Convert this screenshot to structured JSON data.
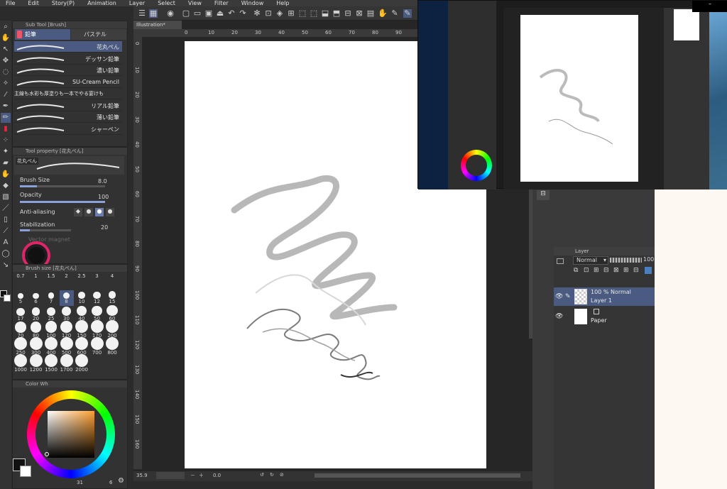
{
  "menubar": {
    "items": [
      "File",
      "Edit",
      "Story(P)",
      "Animation",
      "Layer",
      "Select",
      "View",
      "Filter",
      "Window",
      "Help"
    ]
  },
  "canvas": {
    "tab_title": "Illustration*",
    "ruler_top": [
      "0",
      "10",
      "20",
      "30",
      "40",
      "50",
      "60",
      "70",
      "80",
      "90",
      "100",
      "110",
      "120"
    ],
    "ruler_left": [
      "0",
      "10",
      "20",
      "30",
      "40",
      "50",
      "60",
      "70",
      "80",
      "90",
      "100",
      "110",
      "120",
      "130",
      "140",
      "150",
      "160"
    ],
    "zoom": "35.9",
    "angle": "0.0"
  },
  "subtool": {
    "header": "Sub Tool [Brush]",
    "tabs": [
      "鉛筆",
      "パステル"
    ],
    "brushes": [
      "花丸ぺん",
      "デッサン鉛筆",
      "濃い鉛筆",
      "SU-Cream Pencil",
      "主線も水彩も厚塗りも一本でやる宴けも",
      "リアル鉛筆",
      "薄い鉛筆",
      "シャーペン"
    ]
  },
  "toolprop": {
    "header": "Tool property [花丸ぺん]",
    "preset": "花丸ぺん",
    "brush_size_label": "Brush Size",
    "brush_size_value": "8.0",
    "opacity_label": "Opacity",
    "opacity_value": "100",
    "antialias_label": "Anti-aliasing",
    "stabilization_label": "Stabilization",
    "stabilization_value": "20",
    "vector_label": "Vector magnet"
  },
  "brushsize": {
    "header": "Brush size [花丸ぺん]",
    "values": [
      "0.7",
      "1",
      "1.5",
      "2",
      "2.5",
      "3",
      "4",
      "5",
      "6",
      "7",
      "8",
      "10",
      "12",
      "15",
      "17",
      "20",
      "25",
      "30",
      "40",
      "50",
      "60",
      "70",
      "80",
      "100",
      "120",
      "150",
      "170",
      "200",
      "250",
      "300",
      "400",
      "500",
      "600",
      "700",
      "800",
      "1000",
      "1200",
      "1500",
      "1700",
      "2000"
    ],
    "selected": "8"
  },
  "color": {
    "header": "Color Wh",
    "main": "#111111",
    "sub": "#ffffff",
    "hue_square_top": "#ffa030",
    "value_a": "31",
    "value_b": "6"
  },
  "layers": {
    "header": "Layer",
    "blend": "Normal",
    "opacity": "100",
    "items": [
      {
        "top": "100 % Normal",
        "name": "Layer 1"
      },
      {
        "top": "",
        "name": "Paper"
      }
    ]
  }
}
